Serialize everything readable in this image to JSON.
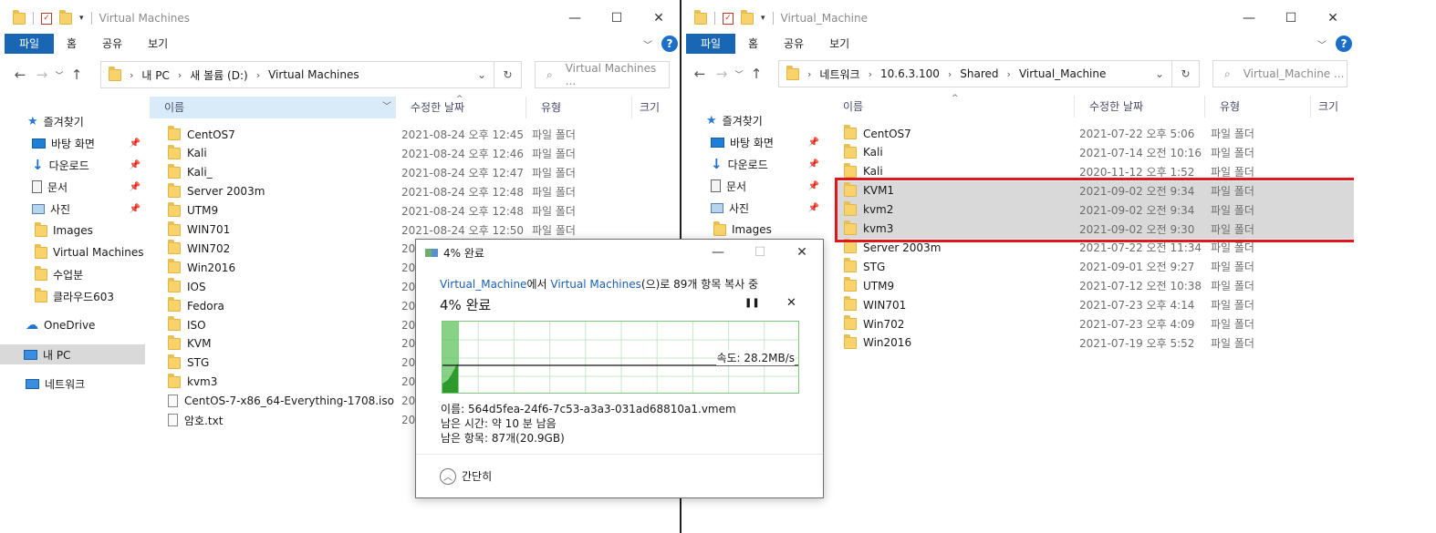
{
  "left_window": {
    "title": "Virtual Machines",
    "ribbon_tabs": [
      "파일",
      "홈",
      "공유",
      "보기"
    ],
    "breadcrumbs": [
      "내 PC",
      "새 볼륨 (D:)",
      "Virtual Machines"
    ],
    "search_placeholder": "Virtual Machines ...",
    "sidebar": [
      {
        "label": "즐겨찾기",
        "icon": "star-icon"
      },
      {
        "label": "바탕 화면",
        "icon": "desktop-icon"
      },
      {
        "label": "다운로드",
        "icon": "download-icon"
      },
      {
        "label": "문서",
        "icon": "document-icon"
      },
      {
        "label": "사진",
        "icon": "pictures-icon"
      },
      {
        "label": "Images",
        "icon": "folder-icon"
      },
      {
        "label": "Virtual Machines",
        "icon": "folder-icon"
      },
      {
        "label": "수업분",
        "icon": "folder-icon"
      },
      {
        "label": "클라우드603",
        "icon": "folder-icon"
      },
      {
        "label": "OneDrive",
        "icon": "cloud-icon"
      },
      {
        "label": "내 PC",
        "icon": "pc-icon"
      },
      {
        "label": "네트워크",
        "icon": "network-icon"
      }
    ],
    "columns": [
      "이름",
      "수정한 날짜",
      "유형",
      "크기"
    ],
    "files": [
      {
        "name": "CentOS7",
        "date": "2021-08-24 오후 12:45",
        "type": "파일 폴더",
        "kind": "folder"
      },
      {
        "name": "Kali",
        "date": "2021-08-24 오후 12:46",
        "type": "파일 폴더",
        "kind": "folder"
      },
      {
        "name": "Kali_",
        "date": "2021-08-24 오후 12:47",
        "type": "파일 폴더",
        "kind": "folder"
      },
      {
        "name": "Server 2003m",
        "date": "2021-08-24 오후 12:48",
        "type": "파일 폴더",
        "kind": "folder"
      },
      {
        "name": "UTM9",
        "date": "2021-08-24 오후 12:48",
        "type": "파일 폴더",
        "kind": "folder"
      },
      {
        "name": "WIN701",
        "date": "2021-08-24 오후 12:50",
        "type": "파일 폴더",
        "kind": "folder"
      },
      {
        "name": "WIN702",
        "date": "20",
        "type": "",
        "kind": "folder"
      },
      {
        "name": "Win2016",
        "date": "20",
        "type": "",
        "kind": "folder"
      },
      {
        "name": "IOS",
        "date": "20",
        "type": "",
        "kind": "folder"
      },
      {
        "name": "Fedora",
        "date": "20",
        "type": "",
        "kind": "folder"
      },
      {
        "name": "ISO",
        "date": "20",
        "type": "",
        "kind": "folder"
      },
      {
        "name": "KVM",
        "date": "20",
        "type": "",
        "kind": "folder"
      },
      {
        "name": "STG",
        "date": "20",
        "type": "",
        "kind": "folder"
      },
      {
        "name": "kvm3",
        "date": "20",
        "type": "",
        "kind": "folder"
      },
      {
        "name": "CentOS-7-x86_64-Everything-1708.iso",
        "date": "20",
        "type": "",
        "kind": "iso"
      },
      {
        "name": "암호.txt",
        "date": "20",
        "type": "",
        "kind": "txt"
      }
    ]
  },
  "right_window": {
    "title": "Virtual_Machine",
    "ribbon_tabs": [
      "파일",
      "홈",
      "공유",
      "보기"
    ],
    "breadcrumbs": [
      "네트워크",
      "10.6.3.100",
      "Shared",
      "Virtual_Machine"
    ],
    "search_placeholder": "Virtual_Machine ...",
    "sidebar": [
      {
        "label": "즐겨찾기",
        "icon": "star-icon"
      },
      {
        "label": "바탕 화면",
        "icon": "desktop-icon"
      },
      {
        "label": "다운로드",
        "icon": "download-icon"
      },
      {
        "label": "문서",
        "icon": "document-icon"
      },
      {
        "label": "사진",
        "icon": "pictures-icon"
      },
      {
        "label": "Images",
        "icon": "folder-icon"
      }
    ],
    "columns": [
      "이름",
      "수정한 날짜",
      "유형",
      "크기"
    ],
    "files": [
      {
        "name": "CentOS7",
        "date": "2021-07-22 오후 5:06",
        "type": "파일 폴더",
        "selected": false
      },
      {
        "name": "Kali",
        "date": "2021-07-14 오전 10:16",
        "type": "파일 폴더",
        "selected": false
      },
      {
        "name": "Kali",
        "date": "2020-11-12 오후 1:52",
        "type": "파일 폴더",
        "selected": false
      },
      {
        "name": "KVM1",
        "date": "2021-09-02 오전 9:34",
        "type": "파일 폴더",
        "selected": true
      },
      {
        "name": "kvm2",
        "date": "2021-09-02 오전 9:34",
        "type": "파일 폴더",
        "selected": true
      },
      {
        "name": "kvm3",
        "date": "2021-09-02 오전 9:30",
        "type": "파일 폴더",
        "selected": true
      },
      {
        "name": "Server 2003m",
        "date": "2021-07-22 오전 11:34",
        "type": "파일 폴더",
        "selected": false
      },
      {
        "name": "STG",
        "date": "2021-09-01 오전 9:27",
        "type": "파일 폴더",
        "selected": false
      },
      {
        "name": "UTM9",
        "date": "2021-07-12 오전 10:38",
        "type": "파일 폴더",
        "selected": false
      },
      {
        "name": "WIN701",
        "date": "2021-07-23 오후 4:14",
        "type": "파일 폴더",
        "selected": false
      },
      {
        "name": "Win702",
        "date": "2021-07-23 오후 4:09",
        "type": "파일 폴더",
        "selected": false
      },
      {
        "name": "Win2016",
        "date": "2021-07-19 오후 5:52",
        "type": "파일 폴더",
        "selected": false
      }
    ]
  },
  "copy_dialog": {
    "title": "4% 완료",
    "source": "Virtual_Machine",
    "source_suffix": "에서",
    "dest": "Virtual Machines",
    "dest_suffix": "(으)로 89개 항목 복사 중",
    "heading": "4% 완료",
    "progress_fraction": 0.04,
    "speed": "속도: 28.2MB/s",
    "name_line": "이름: 564d5fea-24f6-7c53-a3a3-031ad68810a1.vmem",
    "time_line": "남은 시간: 약 10 분 남음",
    "items_line": "남은 항목: 87개(20.9GB)",
    "less_details": "간단히",
    "pause_label": "❚❚",
    "cancel_label": "✕"
  },
  "colors": {
    "file_tab": "#1966b5",
    "selection": "#d9d9d9",
    "highlight_box": "#e0161d",
    "graph_green": "#3cb43c",
    "link": "#1a5fb4"
  }
}
